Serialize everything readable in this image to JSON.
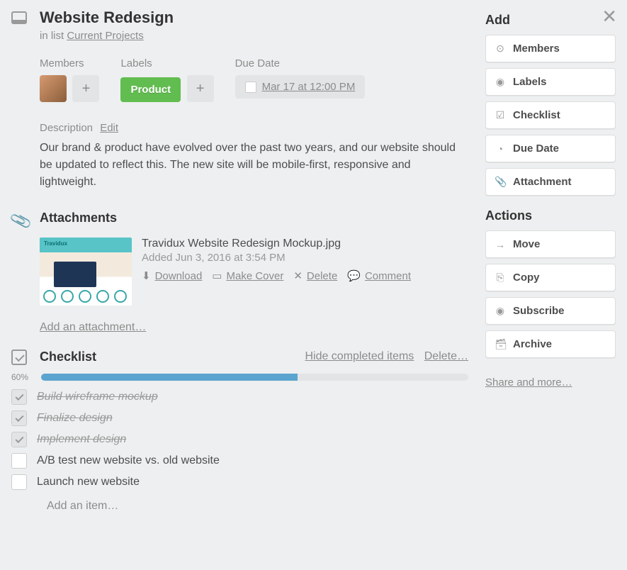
{
  "card": {
    "title": "Website Redesign",
    "in_list_prefix": "in list ",
    "list_name": "Current Projects"
  },
  "meta": {
    "members_label": "Members",
    "labels_label": "Labels",
    "due_label": "Due Date",
    "label_chip": "Product",
    "due_text": "Mar 17 at 12:00 PM"
  },
  "description": {
    "heading": "Description",
    "edit": "Edit",
    "text": "Our brand & product have evolved over the past two years, and our website should be updated to reflect this. The new site will be mobile-first, responsive and lightweight."
  },
  "attachments": {
    "heading": "Attachments",
    "item": {
      "name": "Travidux Website Redesign Mockup.jpg",
      "meta": "Added Jun 3, 2016 at 3:54 PM",
      "download": "Download",
      "make_cover": "Make Cover",
      "delete": "Delete",
      "comment": "Comment"
    },
    "add": "Add an attachment…"
  },
  "checklist": {
    "heading": "Checklist",
    "hide": "Hide completed items",
    "delete": "Delete…",
    "percent": "60%",
    "percent_value": 60,
    "items": [
      {
        "text": "Build wireframe mockup",
        "done": true
      },
      {
        "text": "Finalize design",
        "done": true
      },
      {
        "text": "Implement design",
        "done": true
      },
      {
        "text": "A/B test new website vs. old website",
        "done": false
      },
      {
        "text": "Launch new website",
        "done": false
      }
    ],
    "add_item": "Add an item…"
  },
  "sidebar": {
    "add_heading": "Add",
    "actions_heading": "Actions",
    "add": [
      {
        "icon": "person-icon",
        "glyph": "⊙",
        "label": "Members"
      },
      {
        "icon": "tag-icon",
        "glyph": "◉",
        "label": "Labels"
      },
      {
        "icon": "checklist-icon",
        "glyph": "☑",
        "label": "Checklist"
      },
      {
        "icon": "clock-icon",
        "glyph": "◔",
        "label": "Due Date"
      },
      {
        "icon": "attachment-icon",
        "glyph": "📎",
        "label": "Attachment"
      }
    ],
    "actions": [
      {
        "icon": "arrow-icon",
        "glyph": "→",
        "label": "Move"
      },
      {
        "icon": "copy-icon",
        "glyph": "⎘",
        "label": "Copy"
      },
      {
        "icon": "eye-icon",
        "glyph": "◉",
        "label": "Subscribe"
      },
      {
        "icon": "archive-icon",
        "glyph": "🗃",
        "label": "Archive"
      }
    ],
    "share": "Share and more…"
  }
}
